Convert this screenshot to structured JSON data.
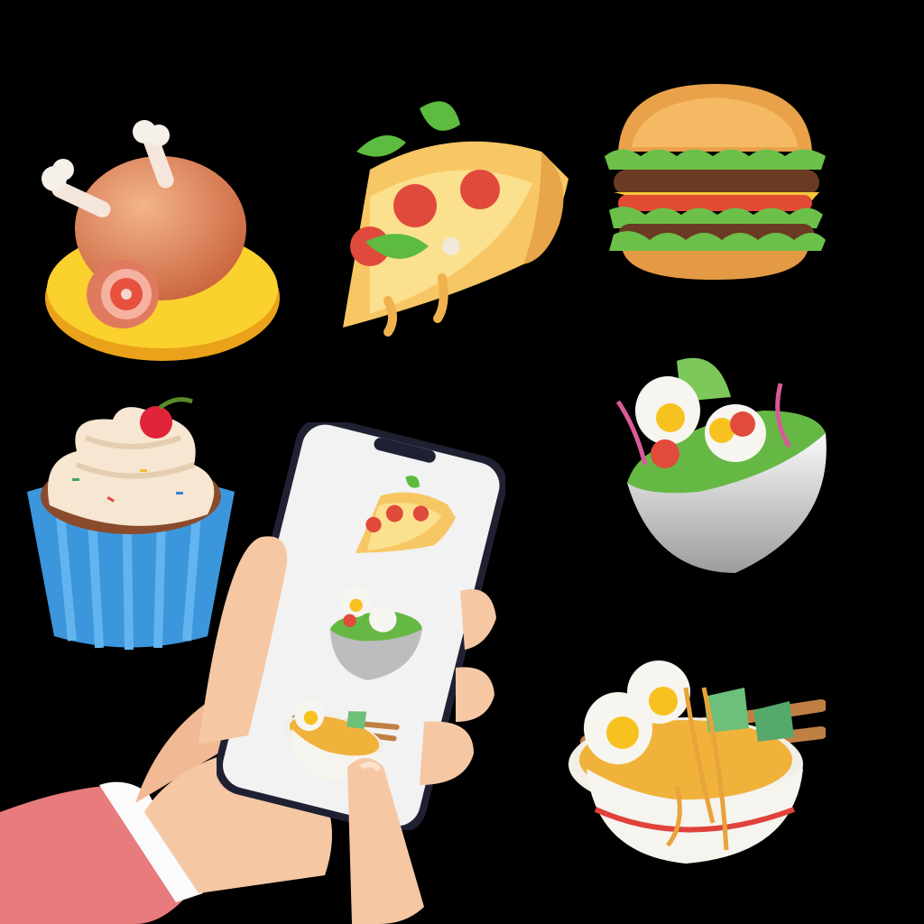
{
  "scene": {
    "background": "#000000",
    "floating_items": [
      {
        "name": "roast-chicken-icon"
      },
      {
        "name": "pizza-slice-icon"
      },
      {
        "name": "burger-icon"
      },
      {
        "name": "salad-bowl-icon"
      },
      {
        "name": "cupcake-icon"
      },
      {
        "name": "ramen-bowl-icon"
      }
    ]
  },
  "phone": {
    "screen_background": "#f2f2f2",
    "frame_color": "#1f2133",
    "menu_items": [
      {
        "icon": "pizza-slice-icon"
      },
      {
        "icon": "salad-bowl-icon"
      },
      {
        "icon": "ramen-bowl-icon"
      }
    ]
  },
  "hand": {
    "skin_color": "#f6c7a3",
    "sleeve_color": "#e77b7d",
    "cuff_color": "#fbfbfb"
  }
}
